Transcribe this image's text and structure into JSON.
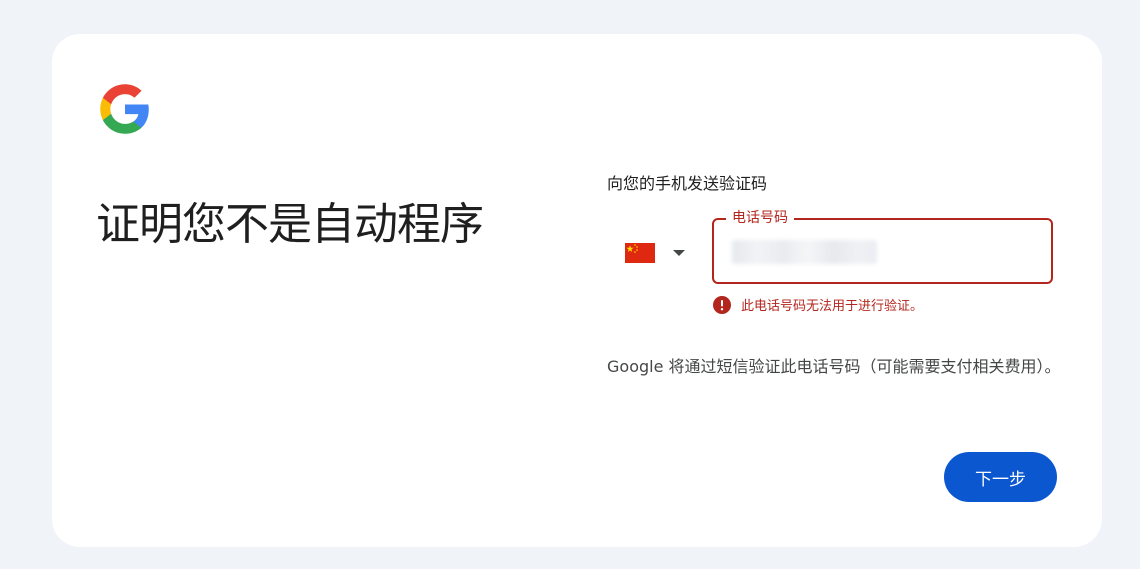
{
  "page": {
    "title": "证明您不是自动程序"
  },
  "logo": {
    "icon": "google-g-logo"
  },
  "form": {
    "instruction": "向您的手机发送验证码",
    "country": {
      "code": "CN",
      "icon": "china-flag-icon"
    },
    "phone": {
      "label": "电话号码",
      "value_obscured": true
    },
    "error": {
      "icon": "error-icon",
      "message": "此电话号码无法用于进行验证。"
    },
    "sms_notice": "Google 将通过短信验证此电话号码（可能需要支付相关费用）。"
  },
  "actions": {
    "next_label": "下一步"
  },
  "colors": {
    "background": "#f0f4f9",
    "card": "#ffffff",
    "error": "#b3261e",
    "primary": "#0b57d0"
  }
}
